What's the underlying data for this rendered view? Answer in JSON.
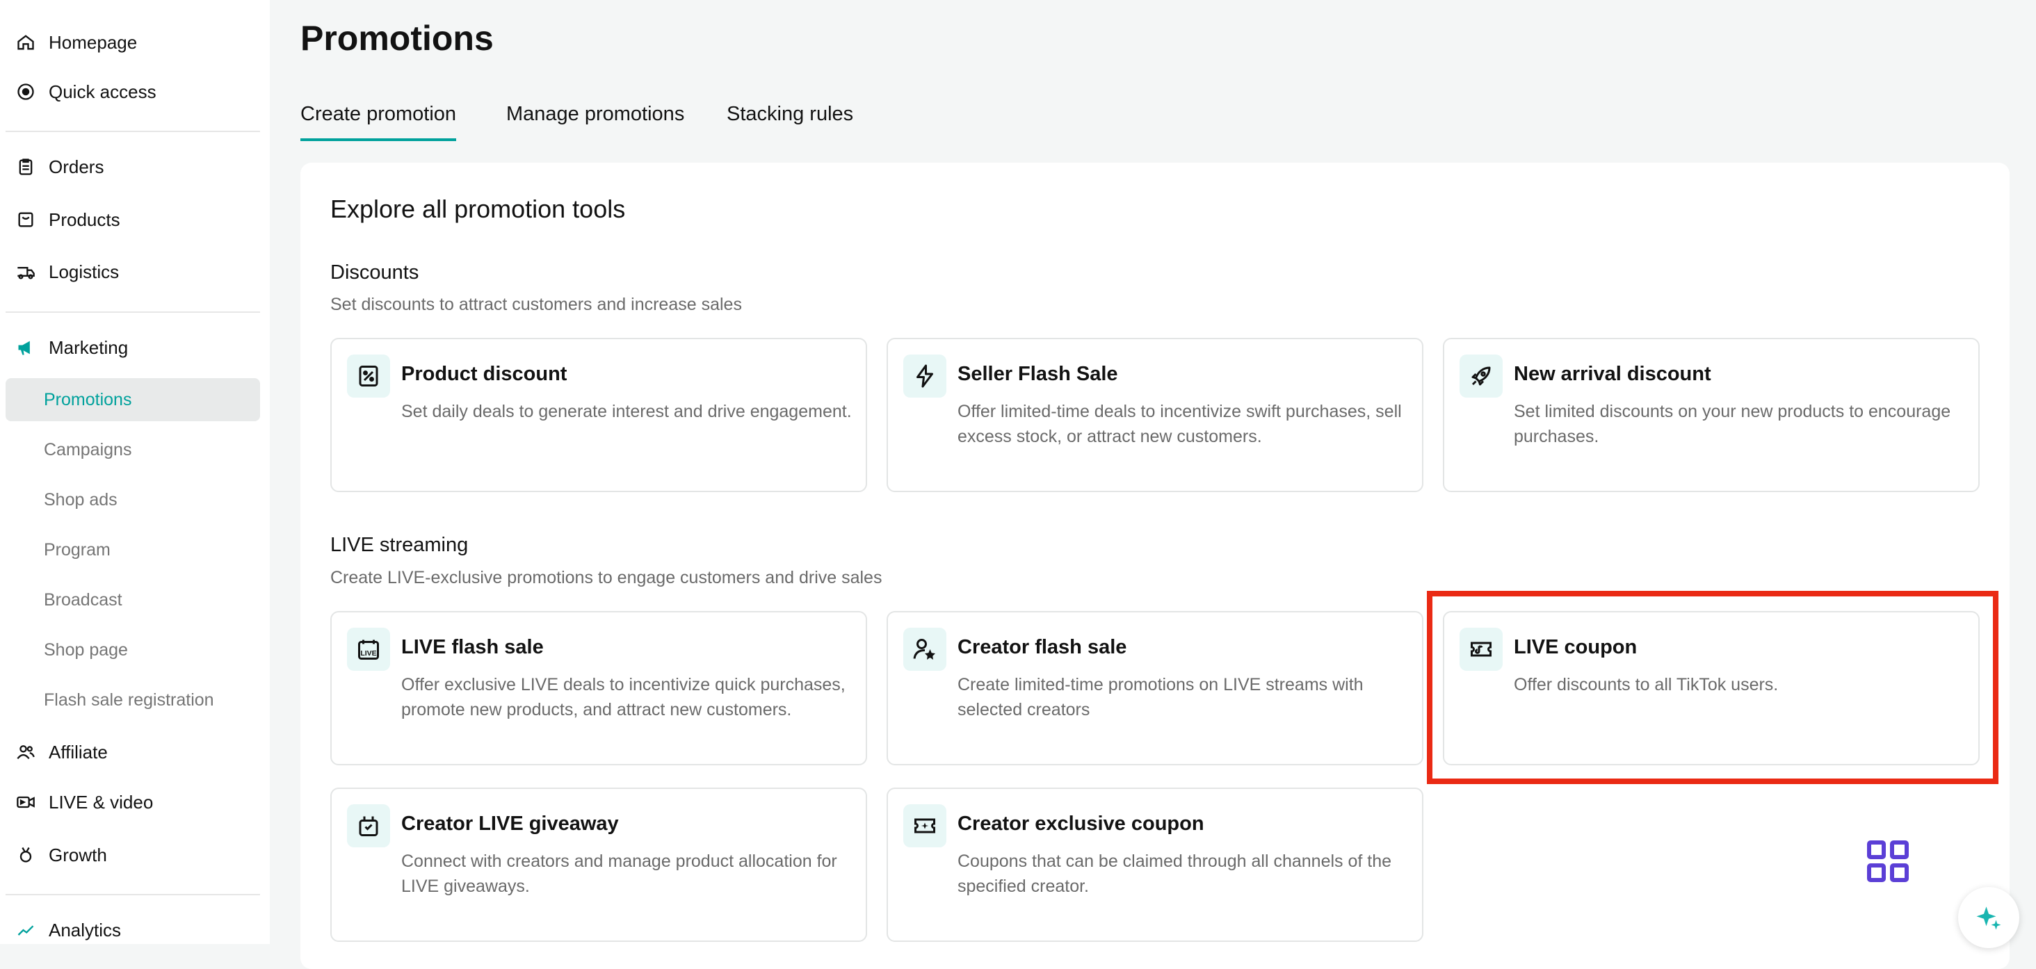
{
  "sidebar": {
    "homepage": "Homepage",
    "quick_access": "Quick access",
    "orders": "Orders",
    "products": "Products",
    "logistics": "Logistics",
    "marketing": "Marketing",
    "marketing_items": [
      "Promotions",
      "Campaigns",
      "Shop ads",
      "Program",
      "Broadcast",
      "Shop page",
      "Flash sale registration"
    ],
    "affiliate": "Affiliate",
    "live_video": "LIVE & video",
    "growth": "Growth",
    "analytics": "Analytics"
  },
  "page": {
    "title": "Promotions",
    "tabs": [
      "Create promotion",
      "Manage promotions",
      "Stacking rules"
    ],
    "panel_title": "Explore all promotion tools"
  },
  "discounts": {
    "title": "Discounts",
    "desc": "Set discounts to attract customers and increase sales",
    "cards": [
      {
        "title": "Product discount",
        "desc": "Set daily deals to generate interest and drive engagement.",
        "icon": "product-discount-icon"
      },
      {
        "title": "Seller Flash Sale",
        "desc": "Offer limited-time deals to incentivize swift purchases, sell excess stock, or attract new customers.",
        "icon": "lightning-icon"
      },
      {
        "title": "New arrival discount",
        "desc": "Set limited discounts on your new products to encourage purchases.",
        "icon": "rocket-icon"
      }
    ]
  },
  "live": {
    "title": "LIVE streaming",
    "desc": "Create LIVE-exclusive promotions to engage customers and drive sales",
    "cards": [
      {
        "title": "LIVE flash sale",
        "desc": "Offer exclusive LIVE deals to incentivize quick purchases, promote new products, and attract new customers.",
        "icon": "live-calendar-icon"
      },
      {
        "title": "Creator flash sale",
        "desc": "Create limited-time promotions on LIVE streams with selected creators",
        "icon": "creator-star-icon"
      },
      {
        "title": "LIVE coupon",
        "desc": "Offer discounts to all TikTok users.",
        "icon": "live-coupon-icon"
      },
      {
        "title": "Creator LIVE giveaway",
        "desc": "Connect with creators and manage product allocation for LIVE giveaways.",
        "icon": "giveaway-icon"
      },
      {
        "title": "Creator exclusive coupon",
        "desc": "Coupons that can be claimed through all channels of the specified creator.",
        "icon": "creator-coupon-icon"
      }
    ]
  },
  "colors": {
    "accent": "#00a19c",
    "highlight": "#ea2a14",
    "grid_icon": "#5b3fd6"
  }
}
